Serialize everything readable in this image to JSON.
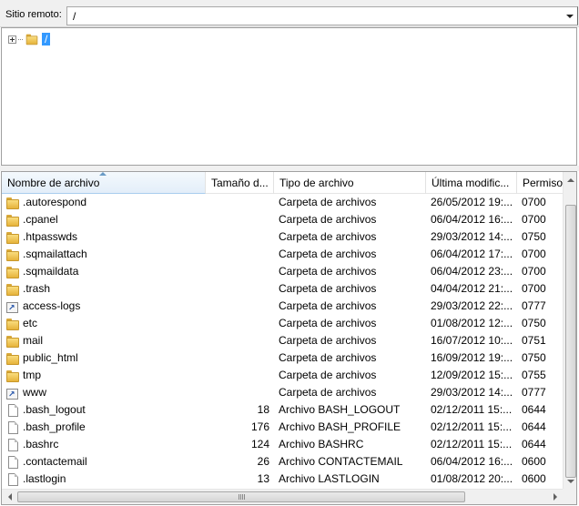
{
  "remote": {
    "label": "Sitio remoto:",
    "path": "/"
  },
  "tree": {
    "root_label": "/"
  },
  "list": {
    "columns": [
      {
        "label": "Nombre de archivo",
        "sorted": "ascending"
      },
      {
        "label": "Tamaño d..."
      },
      {
        "label": "Tipo de archivo"
      },
      {
        "label": "Última modific..."
      },
      {
        "label": "Permiso"
      }
    ],
    "rows": [
      {
        "icon": "folder-icon",
        "name": ".autorespond",
        "size": "",
        "type": "Carpeta de archivos",
        "modified": "26/05/2012 19:...",
        "perms": "0700"
      },
      {
        "icon": "folder-icon",
        "name": ".cpanel",
        "size": "",
        "type": "Carpeta de archivos",
        "modified": "06/04/2012 16:...",
        "perms": "0700"
      },
      {
        "icon": "folder-icon",
        "name": ".htpasswds",
        "size": "",
        "type": "Carpeta de archivos",
        "modified": "29/03/2012 14:...",
        "perms": "0750"
      },
      {
        "icon": "folder-icon",
        "name": ".sqmailattach",
        "size": "",
        "type": "Carpeta de archivos",
        "modified": "06/04/2012 17:...",
        "perms": "0700"
      },
      {
        "icon": "folder-icon",
        "name": ".sqmaildata",
        "size": "",
        "type": "Carpeta de archivos",
        "modified": "06/04/2012 23:...",
        "perms": "0700"
      },
      {
        "icon": "folder-icon",
        "name": ".trash",
        "size": "",
        "type": "Carpeta de archivos",
        "modified": "04/04/2012 21:...",
        "perms": "0700"
      },
      {
        "icon": "link-icon",
        "name": "access-logs",
        "size": "",
        "type": "Carpeta de archivos",
        "modified": "29/03/2012 22:...",
        "perms": "0777"
      },
      {
        "icon": "folder-icon",
        "name": "etc",
        "size": "",
        "type": "Carpeta de archivos",
        "modified": "01/08/2012 12:...",
        "perms": "0750"
      },
      {
        "icon": "folder-icon",
        "name": "mail",
        "size": "",
        "type": "Carpeta de archivos",
        "modified": "16/07/2012 10:...",
        "perms": "0751"
      },
      {
        "icon": "folder-icon",
        "name": "public_html",
        "size": "",
        "type": "Carpeta de archivos",
        "modified": "16/09/2012 19:...",
        "perms": "0750"
      },
      {
        "icon": "folder-icon",
        "name": "tmp",
        "size": "",
        "type": "Carpeta de archivos",
        "modified": "12/09/2012 15:...",
        "perms": "0755"
      },
      {
        "icon": "link-icon",
        "name": "www",
        "size": "",
        "type": "Carpeta de archivos",
        "modified": "29/03/2012 14:...",
        "perms": "0777"
      },
      {
        "icon": "file-icon",
        "name": ".bash_logout",
        "size": "18",
        "type": "Archivo BASH_LOGOUT",
        "modified": "02/12/2011 15:...",
        "perms": "0644"
      },
      {
        "icon": "file-icon",
        "name": ".bash_profile",
        "size": "176",
        "type": "Archivo BASH_PROFILE",
        "modified": "02/12/2011 15:...",
        "perms": "0644"
      },
      {
        "icon": "file-icon",
        "name": ".bashrc",
        "size": "124",
        "type": "Archivo BASHRC",
        "modified": "02/12/2011 15:...",
        "perms": "0644"
      },
      {
        "icon": "file-icon",
        "name": ".contactemail",
        "size": "26",
        "type": "Archivo CONTACTEMAIL",
        "modified": "06/04/2012 16:...",
        "perms": "0600"
      },
      {
        "icon": "file-icon",
        "name": ".lastlogin",
        "size": "13",
        "type": "Archivo LASTLOGIN",
        "modified": "01/08/2012 20:...",
        "perms": "0600"
      }
    ]
  },
  "colors": {
    "selection": "#3399ff",
    "chrome": "#f0f0f0",
    "folder": "#f0c75a"
  }
}
